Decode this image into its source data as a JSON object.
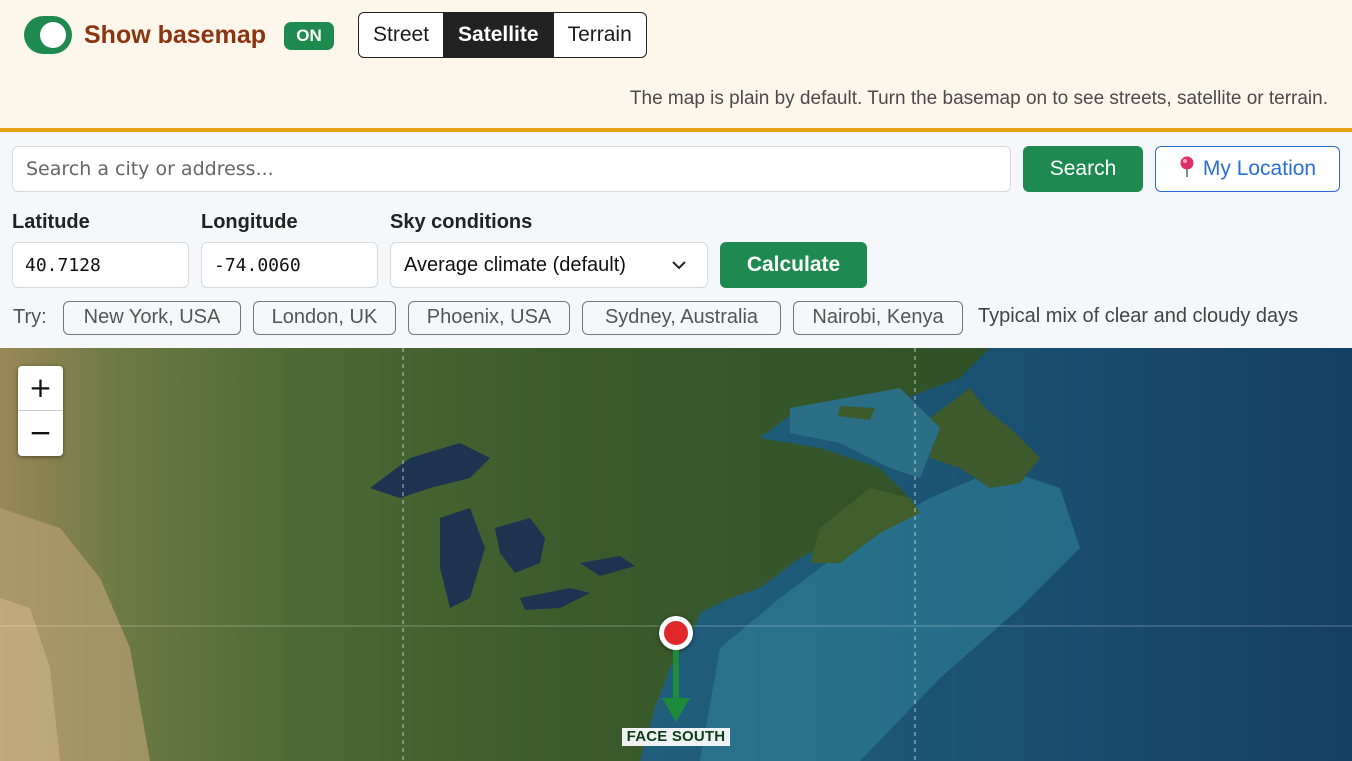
{
  "basemap": {
    "label": "Show basemap",
    "state_badge": "ON",
    "toggle_on": true,
    "layers": [
      "Street",
      "Satellite",
      "Terrain"
    ],
    "active_layer": "Satellite",
    "hint": "The map is plain by default. Turn the basemap on to see streets, satellite or terrain."
  },
  "search": {
    "placeholder": "Search a city or address...",
    "value": "",
    "button_label": "Search",
    "location_button_label": "My Location",
    "location_icon": "pin-icon"
  },
  "coords": {
    "lat_label": "Latitude",
    "lat_value": "40.7128",
    "lon_label": "Longitude",
    "lon_value": "-74.0060"
  },
  "sky": {
    "label": "Sky conditions",
    "selected": "Average climate (default)",
    "note": "Typical mix of clear and cloudy days"
  },
  "calculate_label": "Calculate",
  "presets": {
    "label": "Try:",
    "items": [
      "New York, USA",
      "London, UK",
      "Phoenix, USA",
      "Sydney, Australia",
      "Nairobi, Kenya"
    ]
  },
  "map": {
    "zoom_in": "+",
    "zoom_out": "−",
    "facing_label": "FACE SOUTH",
    "colors": {
      "marker": "#e0282b",
      "arrow": "#1e8a3a",
      "accent_green": "#1e8a4f",
      "banner_border": "#e8a417"
    }
  }
}
